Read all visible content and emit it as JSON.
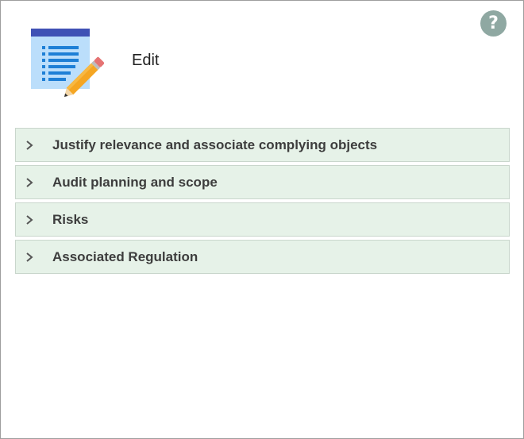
{
  "header": {
    "title": "Edit",
    "icon": "edit-list-pencil-icon",
    "help_label": "?"
  },
  "sections": [
    {
      "label": "Justify relevance and associate complying objects",
      "expanded": false
    },
    {
      "label": "Audit planning and scope",
      "expanded": false
    },
    {
      "label": "Risks",
      "expanded": false
    },
    {
      "label": "Associated Regulation",
      "expanded": false
    }
  ],
  "colors": {
    "section_background": "#e6f2e8",
    "section_border": "#c9d6cc",
    "help_button": "#8fa8a2",
    "icon_list_blue": "#1e7fd6",
    "icon_header": "#3f51b5",
    "pencil": "#f5a623"
  }
}
